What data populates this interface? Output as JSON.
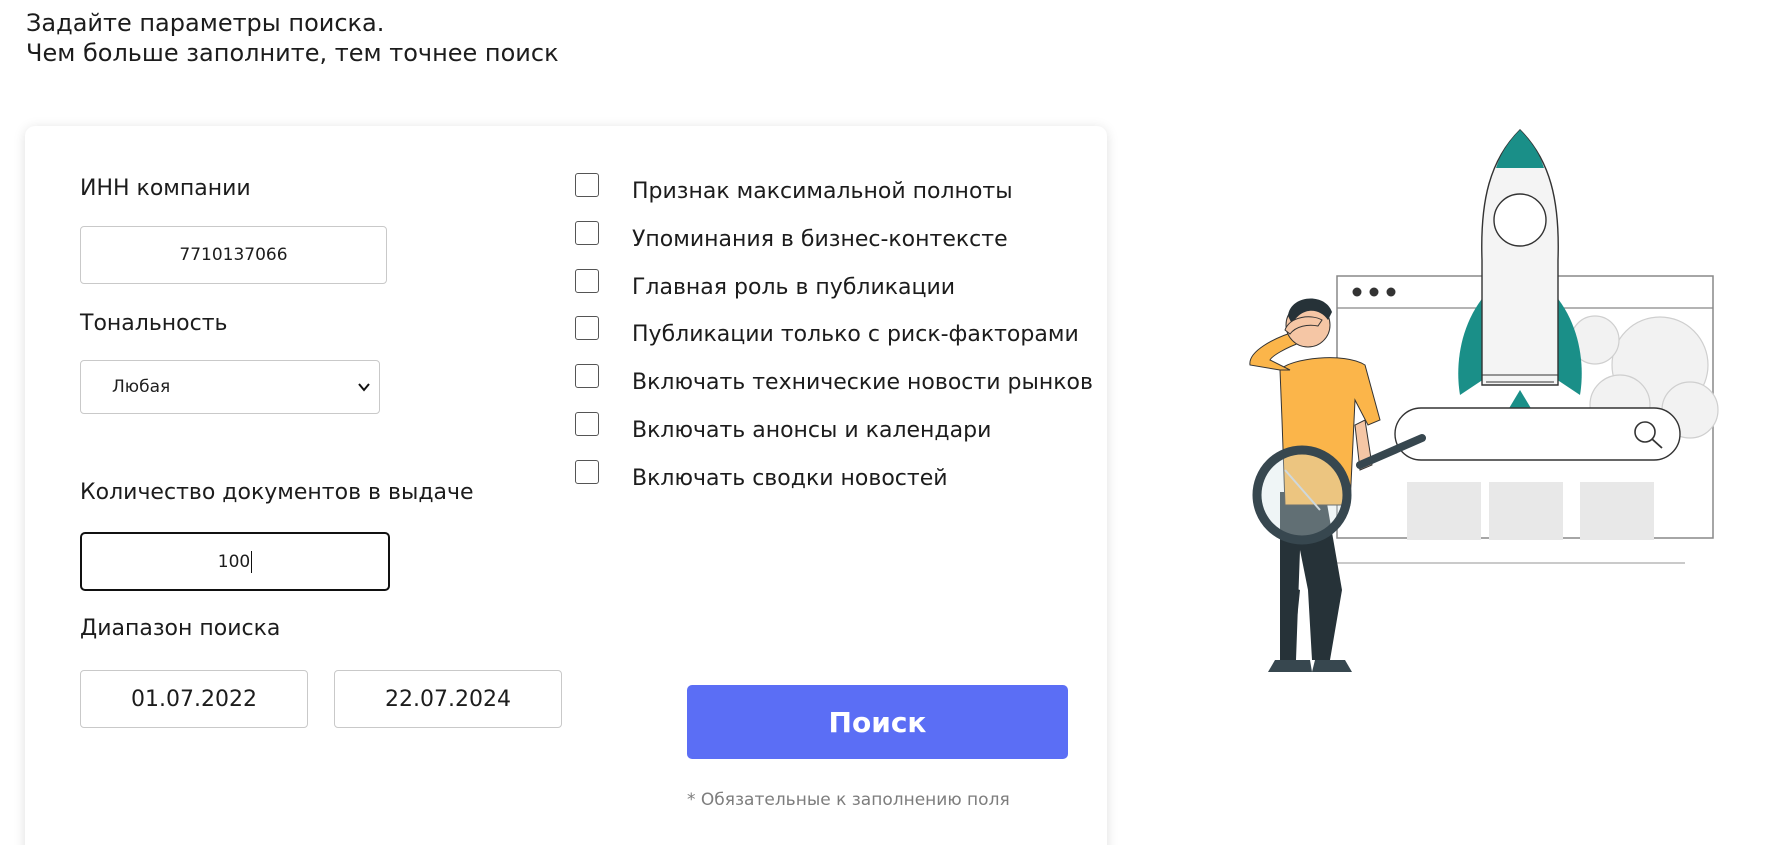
{
  "header": {
    "line1": "Задайте параметры поиска.",
    "line2": "Чем больше заполните, тем точнее поиск"
  },
  "form": {
    "inn_label": "ИНН компании",
    "inn_value": "7710137066",
    "tone_label": "Тональность",
    "tone_value": "Любая",
    "doc_count_label": "Количество документов в выдаче",
    "doc_count_value": "100",
    "range_label": "Диапазон поиска",
    "date_from": "01.07.2022",
    "date_to": "22.07.2024"
  },
  "options": [
    {
      "label": "Признак максимальной полноты",
      "checked": false
    },
    {
      "label": "Упоминания в бизнес-контексте",
      "checked": false
    },
    {
      "label": "Главная роль в публикации",
      "checked": false
    },
    {
      "label": "Публикации только с риск-факторами",
      "checked": false
    },
    {
      "label": "Включать технические новости рынков",
      "checked": false
    },
    {
      "label": "Включать анонсы и календари",
      "checked": false
    },
    {
      "label": "Включать сводки новостей",
      "checked": false
    }
  ],
  "actions": {
    "search_label": "Поиск",
    "required_note": "* Обязательные к заполнению поля"
  },
  "colors": {
    "button": "#5b6ef5",
    "accent_teal": "#1a8f88",
    "shirt": "#fbb54a"
  }
}
